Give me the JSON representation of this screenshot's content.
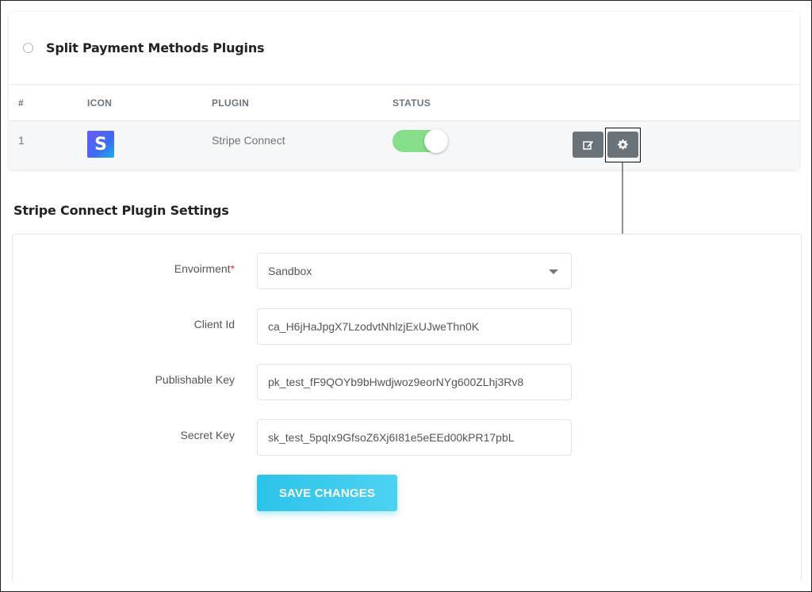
{
  "plugins_card": {
    "title": "Split Payment Methods Plugins",
    "columns": [
      "#",
      "ICON",
      "PLUGIN",
      "STATUS"
    ],
    "rows": [
      {
        "index": "1",
        "icon_letter": "S",
        "plugin": "Stripe Connect",
        "status_enabled": true
      }
    ]
  },
  "settings": {
    "title": "Stripe Connect Plugin Settings",
    "environment": {
      "label": "Envoirment",
      "required_mark": "*",
      "value": "Sandbox"
    },
    "client_id": {
      "label": "Client Id",
      "value": "ca_H6jHaJpgX7LzodvtNhlzjExUJweThn0K"
    },
    "publishable_key": {
      "label": "Publishable Key",
      "value": "pk_test_fF9QOYb9bHwdjwoz9eorNYg600ZLhj3Rv8"
    },
    "secret_key": {
      "label": "Secret Key",
      "value": "sk_test_5pqIx9GfsoZ6Xj6I81e5eEEd00kPR17pbL"
    },
    "save_label": "SAVE CHANGES"
  },
  "colors": {
    "toggle_on": "#86dd8a",
    "action_button": "#6b737a",
    "save_button": "#2cc3ea",
    "required": "#e53935"
  },
  "icons": [
    "radio-icon",
    "stripe-logo-icon",
    "edit-icon",
    "gear-icon",
    "arrow-down-icon",
    "caret-down-icon"
  ]
}
